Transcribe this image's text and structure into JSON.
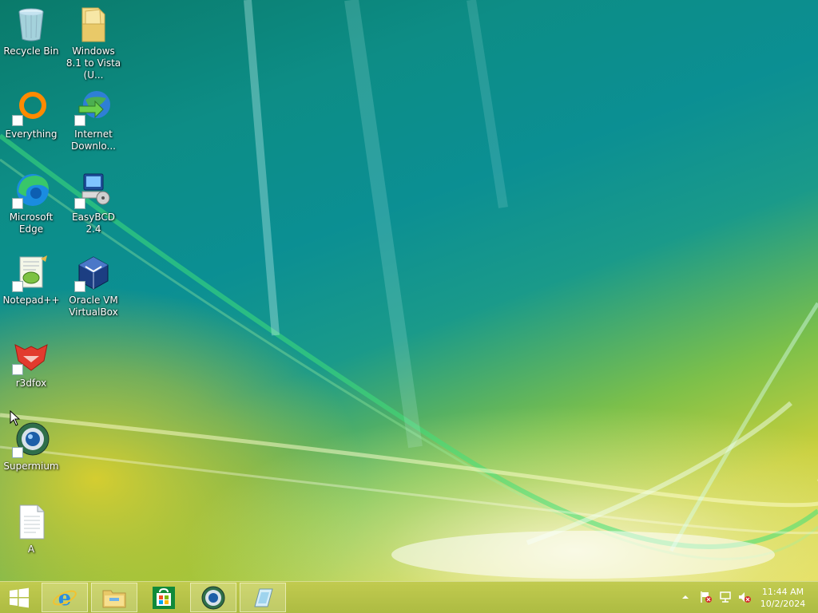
{
  "desktop": {
    "icons": [
      {
        "label": "Recycle Bin",
        "icon": "recycle-bin-icon"
      },
      {
        "label": "Windows 8.1 to Vista (U...",
        "icon": "folder-icon"
      },
      {
        "label": "Everything",
        "icon": "everything-search-icon"
      },
      {
        "label": "Internet Downlo...",
        "icon": "internet-download-manager-icon"
      },
      {
        "label": "Microsoft Edge",
        "icon": "edge-icon"
      },
      {
        "label": "EasyBCD 2.4",
        "icon": "easybcd-icon"
      },
      {
        "label": "Notepad++",
        "icon": "notepad-plus-plus-icon"
      },
      {
        "label": "Oracle VM VirtualBox",
        "icon": "virtualbox-icon"
      },
      {
        "label": "r3dfox",
        "icon": "r3dfox-icon"
      },
      {
        "label": "Supermium",
        "icon": "supermium-icon"
      },
      {
        "label": "A",
        "icon": "text-file-icon"
      }
    ]
  },
  "taskbar": {
    "start": {
      "icon": "windows-logo-icon"
    },
    "pinned": [
      {
        "icon": "internet-explorer-icon",
        "open": true
      },
      {
        "icon": "file-explorer-icon",
        "open": true
      },
      {
        "icon": "store-icon",
        "open": false
      },
      {
        "icon": "supermium-icon",
        "open": true
      },
      {
        "icon": "easybcd-icon",
        "open": true
      }
    ],
    "tray": {
      "icons": [
        "show-hidden-icons-chevron-icon",
        "action-center-flag-icon",
        "network-icon",
        "volume-muted-icon"
      ],
      "time": "11:44 AM",
      "date": "10/2/2024"
    }
  },
  "colors": {
    "taskbar": "#b4bf48",
    "desktop_teal": "#0b8f93",
    "desktop_yellow": "#e3d94a"
  }
}
